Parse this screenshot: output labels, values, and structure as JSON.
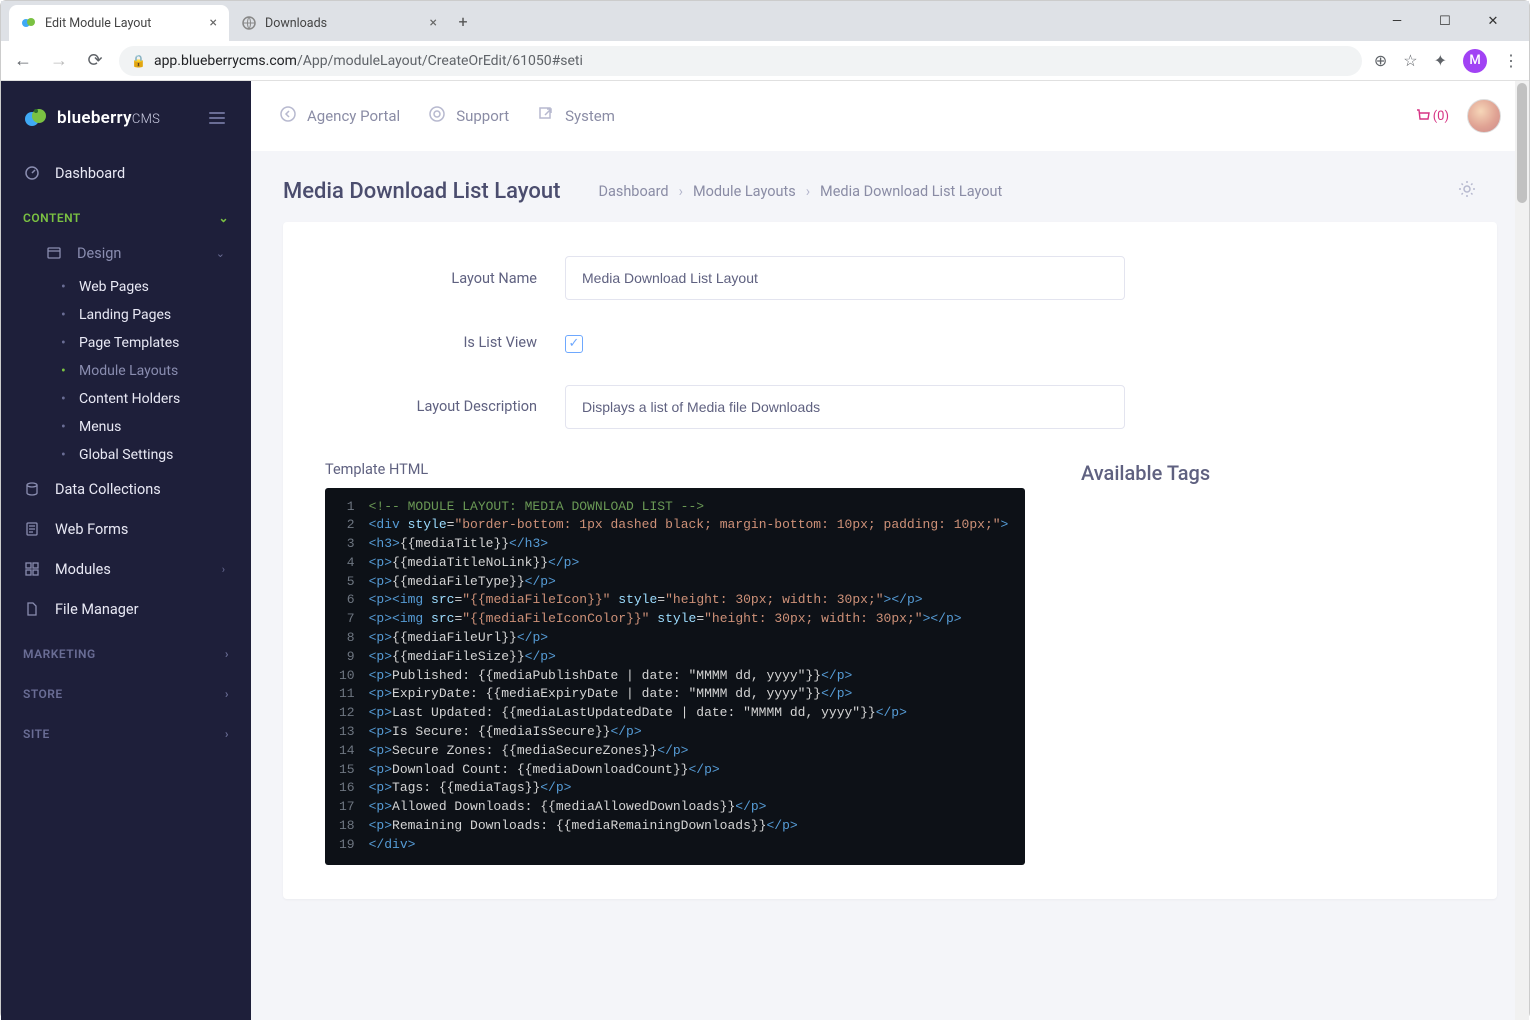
{
  "browser": {
    "tabs": [
      {
        "title": "Edit Module Layout",
        "active": true
      },
      {
        "title": "Downloads",
        "active": false
      }
    ],
    "url_host": "app.blueberrycms.com",
    "url_path": "/App/moduleLayout/CreateOrEdit/61050#seti",
    "avatar_letter": "M"
  },
  "brand": {
    "name": "blueberry",
    "suffix": "CMS"
  },
  "sidebar": {
    "dashboard": "Dashboard",
    "sections": {
      "content": "CONTENT",
      "marketing": "MARKETING",
      "store": "STORE",
      "site": "SITE"
    },
    "design": "Design",
    "design_children": [
      "Web Pages",
      "Landing Pages",
      "Page Templates",
      "Module Layouts",
      "Content Holders",
      "Menus",
      "Global Settings"
    ],
    "items": [
      "Data Collections",
      "Web Forms",
      "Modules",
      "File Manager"
    ]
  },
  "topnav": {
    "agency": "Agency Portal",
    "support": "Support",
    "system": "System",
    "cart_count": "(0)"
  },
  "page": {
    "title": "Media Download List Layout",
    "breadcrumb": [
      "Dashboard",
      "Module Layouts",
      "Media Download List Layout"
    ]
  },
  "form": {
    "layout_name_label": "Layout Name",
    "layout_name_value": "Media Download List Layout",
    "is_list_view_label": "Is List View",
    "is_list_view_checked": true,
    "layout_description_label": "Layout Description",
    "layout_description_value": "Displays a list of Media file Downloads",
    "template_html_label": "Template HTML",
    "available_tags_label": "Available Tags"
  },
  "code_lines": [
    {
      "n": 1,
      "segs": [
        [
          "cmt",
          "<!-- MODULE LAYOUT: MEDIA DOWNLOAD LIST -->"
        ]
      ]
    },
    {
      "n": 2,
      "segs": [
        [
          "tag",
          "<div "
        ],
        [
          "attr",
          "style"
        ],
        [
          "op",
          "="
        ],
        [
          "str",
          "\"border-bottom: 1px dashed black; margin-bottom: 10px; padding: 10px;\""
        ],
        [
          "tag",
          ">"
        ]
      ]
    },
    {
      "n": 3,
      "segs": [
        [
          "tag",
          "<h3>"
        ],
        [
          "txt",
          "{{mediaTitle}}"
        ],
        [
          "tag",
          "</h3>"
        ]
      ]
    },
    {
      "n": 4,
      "segs": [
        [
          "tag",
          "<p>"
        ],
        [
          "txt",
          "{{mediaTitleNoLink}}"
        ],
        [
          "tag",
          "</p>"
        ]
      ]
    },
    {
      "n": 5,
      "segs": [
        [
          "tag",
          "<p>"
        ],
        [
          "txt",
          "{{mediaFileType}}"
        ],
        [
          "tag",
          "</p>"
        ]
      ]
    },
    {
      "n": 6,
      "segs": [
        [
          "tag",
          "<p><img "
        ],
        [
          "attr",
          "src"
        ],
        [
          "op",
          "="
        ],
        [
          "str",
          "\"{{mediaFileIcon}}\" "
        ],
        [
          "attr",
          "style"
        ],
        [
          "op",
          "="
        ],
        [
          "str",
          "\"height: 30px; width: 30px;\""
        ],
        [
          "tag",
          "></p>"
        ]
      ]
    },
    {
      "n": 7,
      "segs": [
        [
          "tag",
          "<p><img "
        ],
        [
          "attr",
          "src"
        ],
        [
          "op",
          "="
        ],
        [
          "str",
          "\"{{mediaFileIconColor}}\" "
        ],
        [
          "attr",
          "style"
        ],
        [
          "op",
          "="
        ],
        [
          "str",
          "\"height: 30px; width: 30px;\""
        ],
        [
          "tag",
          "></p>"
        ]
      ]
    },
    {
      "n": 8,
      "segs": [
        [
          "tag",
          "<p>"
        ],
        [
          "txt",
          "{{mediaFileUrl}}"
        ],
        [
          "tag",
          "</p>"
        ]
      ]
    },
    {
      "n": 9,
      "segs": [
        [
          "tag",
          "<p>"
        ],
        [
          "txt",
          "{{mediaFileSize}}"
        ],
        [
          "tag",
          "</p>"
        ]
      ]
    },
    {
      "n": 10,
      "segs": [
        [
          "tag",
          "<p>"
        ],
        [
          "txt",
          "Published: {{mediaPublishDate | date: \"MMMM dd, yyyy\"}}"
        ],
        [
          "tag",
          "</p>"
        ]
      ]
    },
    {
      "n": 11,
      "segs": [
        [
          "tag",
          "<p>"
        ],
        [
          "txt",
          "ExpiryDate: {{mediaExpiryDate | date: \"MMMM dd, yyyy\"}}"
        ],
        [
          "tag",
          "</p>"
        ]
      ]
    },
    {
      "n": 12,
      "segs": [
        [
          "tag",
          "<p>"
        ],
        [
          "txt",
          "Last Updated: {{mediaLastUpdatedDate | date: \"MMMM dd, yyyy\"}}"
        ],
        [
          "tag",
          "</p>"
        ]
      ]
    },
    {
      "n": 13,
      "segs": [
        [
          "tag",
          "<p>"
        ],
        [
          "txt",
          "Is Secure: {{mediaIsSecure}}"
        ],
        [
          "tag",
          "</p>"
        ]
      ]
    },
    {
      "n": 14,
      "segs": [
        [
          "tag",
          "<p>"
        ],
        [
          "txt",
          "Secure Zones: {{mediaSecureZones}}"
        ],
        [
          "tag",
          "</p>"
        ]
      ]
    },
    {
      "n": 15,
      "segs": [
        [
          "tag",
          "<p>"
        ],
        [
          "txt",
          "Download Count: {{mediaDownloadCount}}"
        ],
        [
          "tag",
          "</p>"
        ]
      ]
    },
    {
      "n": 16,
      "segs": [
        [
          "tag",
          "<p>"
        ],
        [
          "txt",
          "Tags: {{mediaTags}}"
        ],
        [
          "tag",
          "</p>"
        ]
      ]
    },
    {
      "n": 17,
      "segs": [
        [
          "tag",
          "<p>"
        ],
        [
          "txt",
          "Allowed Downloads: {{mediaAllowedDownloads}}"
        ],
        [
          "tag",
          "</p>"
        ]
      ]
    },
    {
      "n": 18,
      "segs": [
        [
          "tag",
          "<p>"
        ],
        [
          "txt",
          "Remaining Downloads: {{mediaRemainingDownloads}}"
        ],
        [
          "tag",
          "</p>"
        ]
      ]
    },
    {
      "n": 19,
      "segs": [
        [
          "tag",
          "</div>"
        ]
      ]
    }
  ]
}
